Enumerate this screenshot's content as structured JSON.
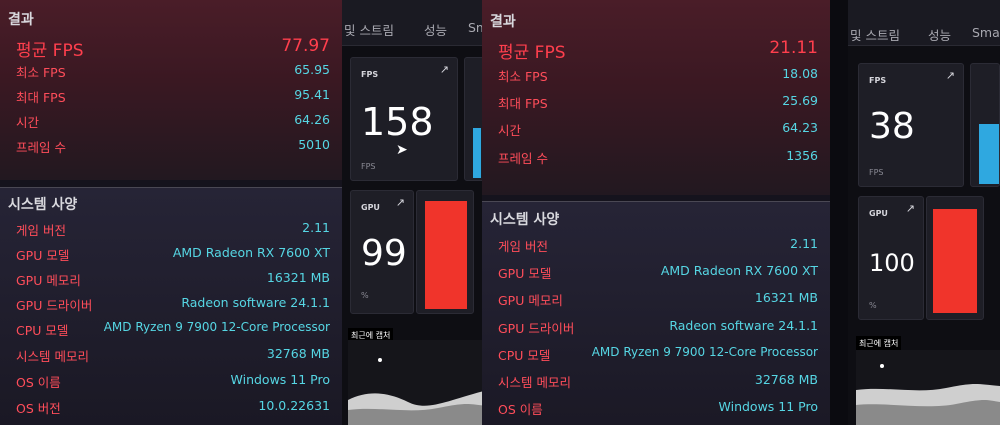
{
  "left_results": {
    "section_results": "결과",
    "avg_fps": {
      "label": "평균 FPS",
      "value": "77.97"
    },
    "rows": [
      {
        "label": "최소 FPS",
        "value": "65.95"
      },
      {
        "label": "최대 FPS",
        "value": "95.41"
      },
      {
        "label": "시간",
        "value": "64.26"
      },
      {
        "label": "프레임 수",
        "value": "5010"
      }
    ],
    "section_system": "시스템 사양",
    "system_rows": [
      {
        "label": "게임 버전",
        "value": "2.11"
      },
      {
        "label": "GPU 모델",
        "value": "AMD Radeon RX 7600 XT"
      },
      {
        "label": "GPU 메모리",
        "value": "16321 MB"
      },
      {
        "label": "GPU 드라이버",
        "value": "Radeon software 24.1.1"
      },
      {
        "label": "CPU 모델",
        "value": "AMD Ryzen 9 7900 12-Core Processor"
      },
      {
        "label": "시스템 메모리",
        "value": "32768 MB"
      },
      {
        "label": "OS 이름",
        "value": "Windows 11 Pro"
      },
      {
        "label": "OS 버전",
        "value": "10.0.22631"
      }
    ]
  },
  "left_perf": {
    "tabs": [
      "및 스트림",
      "성능",
      "Sma"
    ],
    "fps_card": {
      "label": "FPS",
      "value": "158",
      "unit": "FPS",
      "arrow": "↗"
    },
    "gpu_card": {
      "label": "GPU",
      "value": "99",
      "unit": "%",
      "arrow": "↗"
    },
    "recent_capture": "최근에 캡처"
  },
  "right_results": {
    "section_results": "결과",
    "avg_fps": {
      "label": "평균 FPS",
      "value": "21.11"
    },
    "rows": [
      {
        "label": "최소 FPS",
        "value": "18.08"
      },
      {
        "label": "최대 FPS",
        "value": "25.69"
      },
      {
        "label": "시간",
        "value": "64.23"
      },
      {
        "label": "프레임 수",
        "value": "1356"
      }
    ],
    "section_system": "시스템 사양",
    "system_rows": [
      {
        "label": "게임 버전",
        "value": "2.11"
      },
      {
        "label": "GPU 모델",
        "value": "AMD Radeon RX 7600 XT"
      },
      {
        "label": "GPU 메모리",
        "value": "16321 MB"
      },
      {
        "label": "GPU 드라이버",
        "value": "Radeon software 24.1.1"
      },
      {
        "label": "CPU 모델",
        "value": "AMD Ryzen 9 7900 12-Core Processor"
      },
      {
        "label": "시스템 메모리",
        "value": "32768 MB"
      },
      {
        "label": "OS 이름",
        "value": "Windows 11 Pro"
      }
    ]
  },
  "right_perf": {
    "tabs": [
      "및 스트림",
      "성능",
      "Sma"
    ],
    "fps_card": {
      "label": "FPS",
      "value": "38",
      "unit": "FPS",
      "arrow": "↗"
    },
    "gpu_card": {
      "label": "GPU",
      "value": "100",
      "unit": "%",
      "arrow": "↗"
    },
    "recent_capture": "최근에 캡처"
  },
  "colors": {
    "accent_red": "#ff3f4d",
    "value_cyan": "#56d6e4",
    "gpu_bar": "#f0342b",
    "fps_bar": "#2fa8e0"
  }
}
